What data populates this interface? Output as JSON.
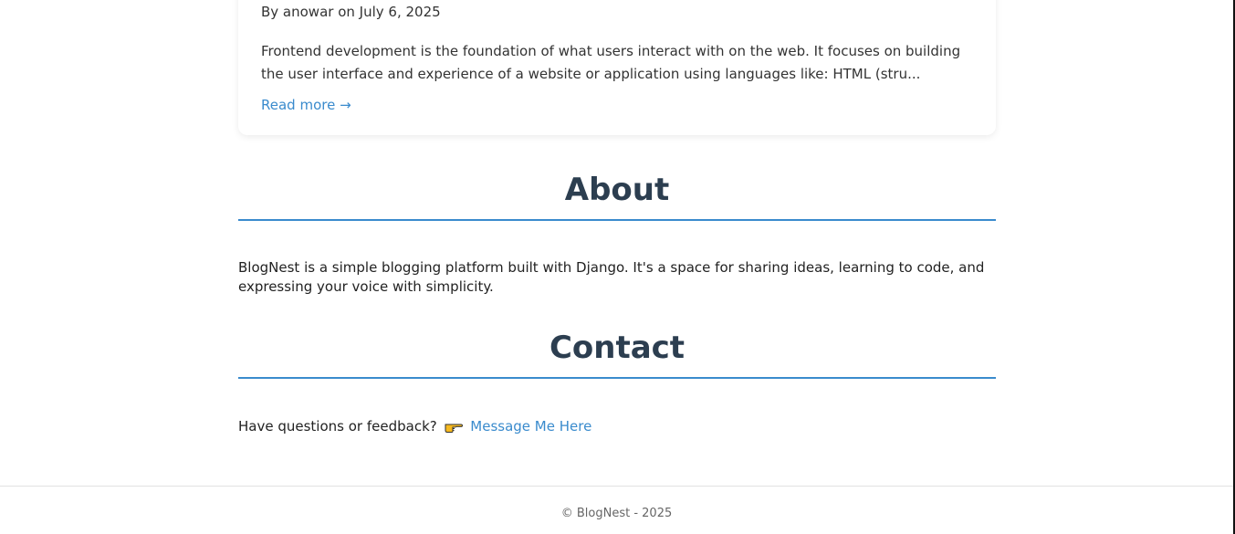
{
  "post": {
    "meta": "By anowar on July 6, 2025",
    "excerpt": "Frontend development is the foundation of what users interact with on the web. It focuses on building the user interface and experience of a website or application using languages like: HTML (stru...",
    "read_more": "Read more →"
  },
  "about": {
    "title": "About",
    "text": "BlogNest is a simple blogging platform built with Django. It's a space for sharing ideas, learning to code, and expressing your voice with simplicity."
  },
  "contact": {
    "title": "Contact",
    "prompt": "Have questions or feedback?",
    "link_text": "Message Me Here",
    "icon": "pointing-hand-icon"
  },
  "footer": {
    "text": "© BlogNest - 2025"
  },
  "colors": {
    "accent": "#3a8bcd",
    "heading": "#2c3e50"
  }
}
